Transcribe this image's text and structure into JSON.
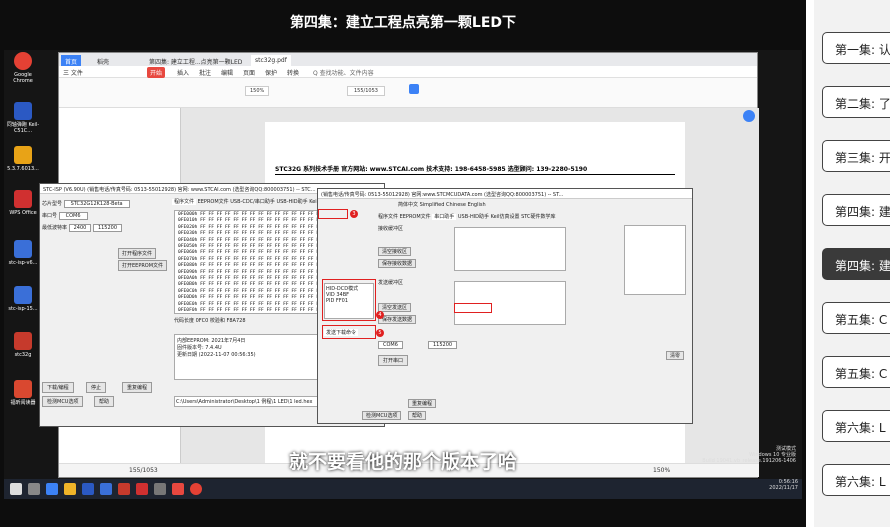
{
  "video": {
    "title": "第四集：建立工程点亮第一颗LED下",
    "subtitle": "就不要看他的那个版本了哈"
  },
  "desktop": {
    "icons": [
      {
        "label": "Google Chrome",
        "color": "#e44134"
      },
      {
        "label": "同轴弹跑 Keil-C51C...",
        "color": "#2b59c3"
      },
      {
        "label": "5.3.7.6013...",
        "color": "#e8a317"
      },
      {
        "label": "WPS Office",
        "color": "#d03030"
      },
      {
        "label": "stc-isp-v6...",
        "color": "#3a6fd8"
      },
      {
        "label": "stc-isp-15...",
        "color": "#3a6fd8"
      },
      {
        "label": "stc32g",
        "color": "#c63a2c"
      },
      {
        "label": "福昕阅读器",
        "color": "#d94830"
      }
    ],
    "tray": {
      "line1": "测试模式",
      "line2": "Windows 10 专业版",
      "line3": "Build 19041.vb_release.191206-1406",
      "time": "0:56:16",
      "date": "2022/11/17"
    }
  },
  "wps": {
    "tabs": [
      "首页",
      "稻壳",
      "第四集: 建立工程...点亮第一颗LED",
      "stc32g.pdf"
    ],
    "menu": [
      "三 文件",
      "开始",
      "插入",
      "批注",
      "编辑",
      "页面",
      "保护",
      "转换",
      "Q 查找功能、文件内容"
    ],
    "page_input": "155/1053",
    "zoom": "150%",
    "doc_header": "STC32G 系列技术手册        官方网站: www.STCAI.com        技术支持: 198-6458-5985        选型顾问: 139-2280-5190",
    "status_page": "155/1053",
    "status_zoom": "150%"
  },
  "isp_left": {
    "title": "STC-ISP (V6.90U) (销售电话/传真号码: 0513-55012928) 官网: www.STCAI.com (选型咨询QQ:800003751) -- STC...",
    "chip_label": "芯片型号",
    "chip_value": "STC32G12K128-Beta",
    "port_label": "串口号",
    "port_value": "COM6",
    "baud_label": "最低波特率",
    "baud_value": "2400",
    "max_baud_value": "115200",
    "buttons": [
      "打开程序文件",
      "打开EEPROM文件",
      "下载/编程",
      "停止",
      "重复编程",
      "检测MCU选项",
      "帮助"
    ],
    "tabs": [
      "程序文件",
      "EEPROM文件",
      "USB-CDC/串口助手",
      "USB-HID助手",
      "Keil仿真设置"
    ],
    "hex_rows": [
      "0FE000h FF FF FF FF FF FF FF FF FF FF FF FF FF FF FF FF",
      "0FE010h FF FF FF FF FF FF FF FF FF FF FF FF FF FF FF FF",
      "0FE020h FF FF FF FF FF FF FF FF FF FF FF FF FF FF FF FF",
      "0FE030h FF FF FF FF FF FF FF FF FF FF FF FF FF FF FF FF",
      "0FE040h FF FF FF FF FF FF FF FF FF FF FF FF FF FF FF FF",
      "0FE050h FF FF FF FF FF FF FF FF FF FF FF FF FF FF FF FF",
      "0FE060h FF FF FF FF FF FF FF FF FF FF FF FF FF FF FF FF",
      "0FE070h FF FF FF FF FF FF FF FF FF FF FF FF FF FF FF FF",
      "0FE080h FF FF FF FF FF FF FF FF FF FF FF FF FF FF FF FF",
      "0FE090h FF FF FF FF FF FF FF FF FF FF FF FF FF FF FF FF",
      "0FE0A0h FF FF FF FF FF FF FF FF FF FF FF FF FF FF FF FF",
      "0FE0B0h FF FF FF FF FF FF FF FF FF FF FF FF FF FF FF FF",
      "0FE0C0h FF FF FF FF FF FF FF FF FF FF FF FF FF FF FF FF",
      "0FE0D0h FF FF FF FF FF FF FF FF FF FF FF FF FF FF FF FF",
      "0FE0E0h FF FF FF FF FF FF FF FF FF FF FF FF FF FF FF FF",
      "0FE0F0h FF FF FF FF FF FF FF FF FF FF FF FF FF FF FF FF"
    ],
    "checksum_label": "代码长度 0FC0  校验和 F8A728",
    "log_lines": [
      "内部EEPROM: 2021年7月4日",
      "固件版本号: 7.4.4U",
      "更新日期 (2022-11-07 00:56:35)"
    ],
    "path": "C:\\Users\\Administrator\\Desktop\\1 例程\\1 LED\\1 led.hex"
  },
  "isp_right": {
    "title": "(销售电话/传真号码: 0513-55012928) 官网:www.STCMCUDATA.com (选型咨询QQ:800003751) -- ST...",
    "lang": [
      "简体中文",
      "Simplified Chinese",
      "English"
    ],
    "tabs": [
      "程序文件",
      "EEPROM文件",
      "串口助手",
      "USB-HID助手",
      "Keil仿真设置",
      "STC硬件数学库"
    ],
    "recv_label": "接收缓冲区",
    "send_label": "发送缓冲区",
    "port_value": "COM6",
    "baud_value": "115200",
    "buttons": [
      "打开程序文件",
      "打开EEPROM文件",
      "清空接收区",
      "保存接收数据",
      "清空发送区",
      "保存发送数据",
      "发送文件",
      "发送数据",
      "自动发送",
      "打开串口",
      "清零",
      "重复编程",
      "检测MCU选项",
      "帮助"
    ],
    "hex_readout": [
      "HID-DCD模式",
      "VID 34BF",
      "PID FF01"
    ],
    "send_hint": "发送下载命令"
  },
  "playlist": {
    "items": [
      {
        "label": "第一集: 认"
      },
      {
        "label": "第二集: 了"
      },
      {
        "label": "第三集: 开"
      },
      {
        "label": "第四集: 建"
      },
      {
        "label": "第四集: 建",
        "current": true
      },
      {
        "label": "第五集: C"
      },
      {
        "label": "第五集: C"
      },
      {
        "label": "第六集: L"
      },
      {
        "label": "第六集: L"
      }
    ]
  }
}
